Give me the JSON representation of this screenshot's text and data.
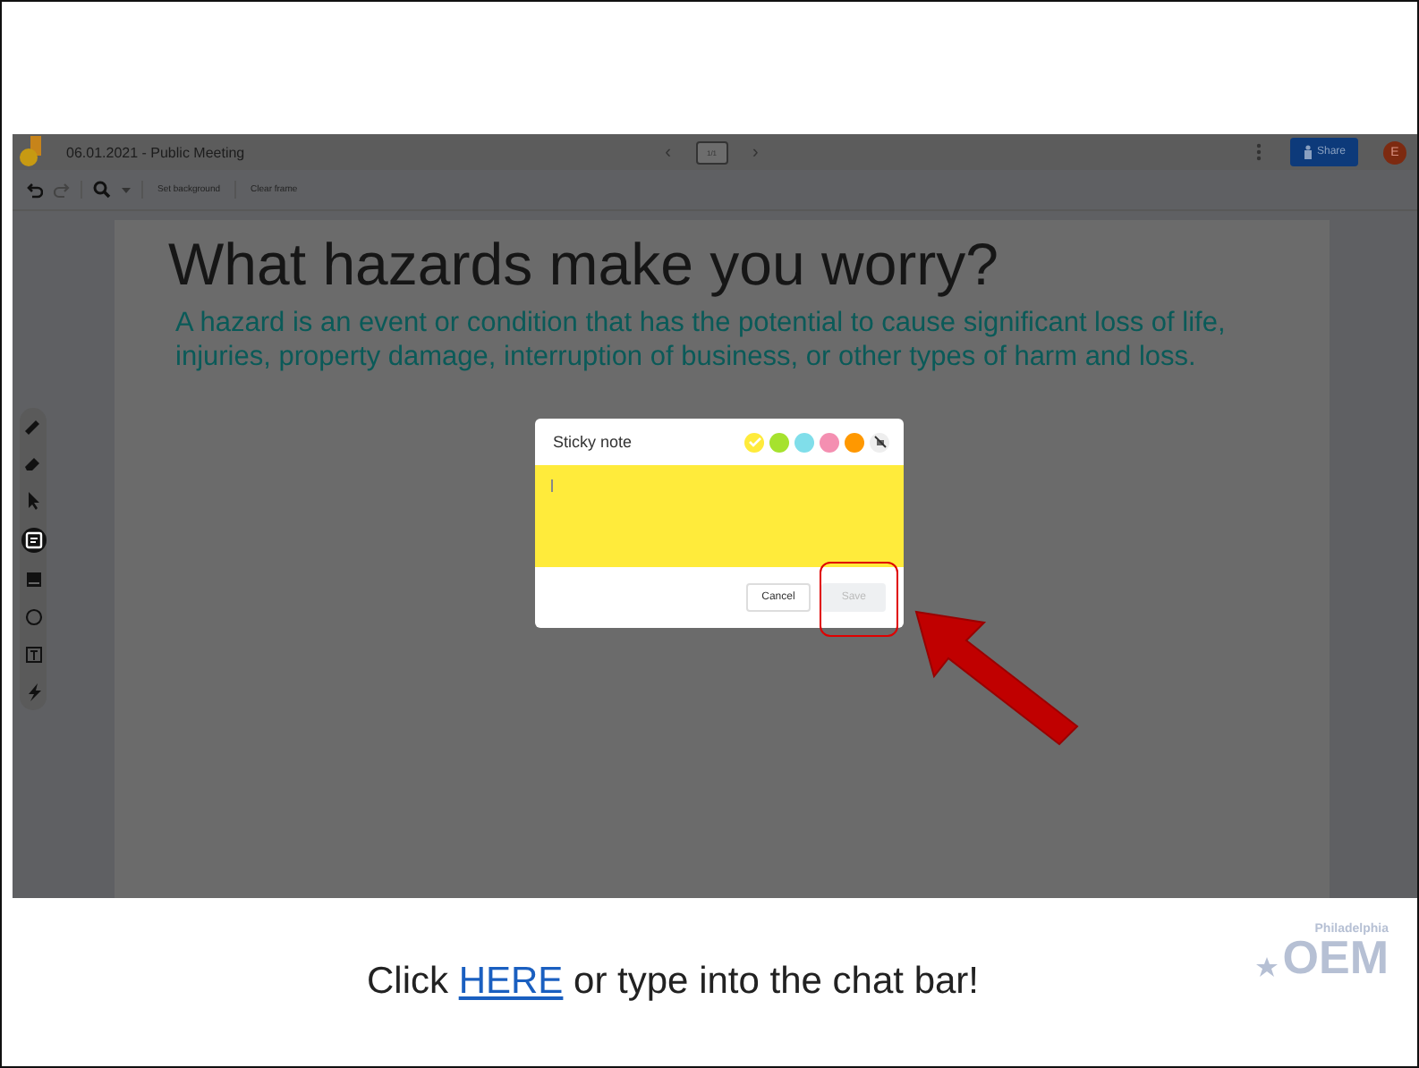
{
  "app": {
    "title": "06.01.2021 - Public Meeting",
    "nav": {
      "prev": "‹",
      "next": "›",
      "frame_label": "1/1"
    },
    "share_button": "Share",
    "avatar": "E"
  },
  "toolbar": {
    "actions": [
      "Set background",
      "Clear frame"
    ]
  },
  "tools": [
    {
      "kind": "pen",
      "selected": false
    },
    {
      "kind": "eraser",
      "selected": false
    },
    {
      "kind": "select",
      "selected": false
    },
    {
      "kind": "sticky",
      "selected": true
    },
    {
      "kind": "image",
      "selected": false
    },
    {
      "kind": "circle",
      "selected": false
    },
    {
      "kind": "textbox",
      "selected": false
    },
    {
      "kind": "laser",
      "selected": false
    }
  ],
  "frame": {
    "heading": "What hazards make you worry?",
    "body": "A hazard is an event or condition that has the potential to cause significant loss of life, injuries, property damage, interruption of business, or other types of harm and loss."
  },
  "dialog": {
    "title": "Sticky note",
    "swatches": [
      {
        "kind": "color",
        "color": "#ffeb3b",
        "selected": true
      },
      {
        "kind": "color",
        "color": "#a6e22e",
        "selected": false
      },
      {
        "kind": "color",
        "color": "#80deea",
        "selected": false
      },
      {
        "kind": "color",
        "color": "#f48fb1",
        "selected": false
      },
      {
        "kind": "color",
        "color": "#ff9800",
        "selected": false
      },
      {
        "kind": "none",
        "selected": false
      }
    ],
    "buttons": [
      {
        "label": "Cancel",
        "disabled": false
      },
      {
        "label": "Save",
        "disabled": true
      }
    ]
  },
  "caption": {
    "before": "Click ",
    "link": "HERE",
    "after": " or type into the chat bar!"
  },
  "logo": {
    "text": "OEM",
    "subtext": "Philadelphia"
  }
}
